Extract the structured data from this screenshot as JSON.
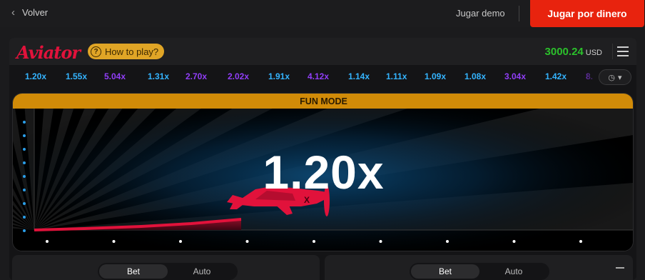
{
  "topbar": {
    "back_label": "Volver",
    "demo_label": "Jugar demo",
    "real_label": "Jugar por dinero"
  },
  "game": {
    "logo": "Aviator",
    "howto_label": "How to play?",
    "balance": "3000.24",
    "currency": "USD"
  },
  "history": [
    {
      "value": "1.20x",
      "color": "#34b4ff"
    },
    {
      "value": "1.55x",
      "color": "#34b4ff"
    },
    {
      "value": "5.04x",
      "color": "#913ef8"
    },
    {
      "value": "1.31x",
      "color": "#34b4ff"
    },
    {
      "value": "2.70x",
      "color": "#913ef8"
    },
    {
      "value": "2.02x",
      "color": "#913ef8"
    },
    {
      "value": "1.91x",
      "color": "#34b4ff"
    },
    {
      "value": "4.12x",
      "color": "#913ef8"
    },
    {
      "value": "1.14x",
      "color": "#34b4ff"
    },
    {
      "value": "1.11x",
      "color": "#34b4ff"
    },
    {
      "value": "1.09x",
      "color": "#34b4ff"
    },
    {
      "value": "1.08x",
      "color": "#34b4ff"
    },
    {
      "value": "3.04x",
      "color": "#913ef8"
    },
    {
      "value": "1.42x",
      "color": "#34b4ff"
    },
    {
      "value": "8.",
      "color": "#913ef8"
    }
  ],
  "stage": {
    "mode_label": "FUN MODE",
    "current_multiplier": "1.20x"
  },
  "bet_panels": [
    {
      "bet_label": "Bet",
      "auto_label": "Auto"
    },
    {
      "bet_label": "Bet",
      "auto_label": "Auto"
    }
  ],
  "colors": {
    "accent_red": "#e1123b",
    "real_button": "#e8230e",
    "balance_green": "#2bc02b",
    "fun_mode_bar": "#d18b08",
    "howto_yellow": "#e0a526"
  }
}
